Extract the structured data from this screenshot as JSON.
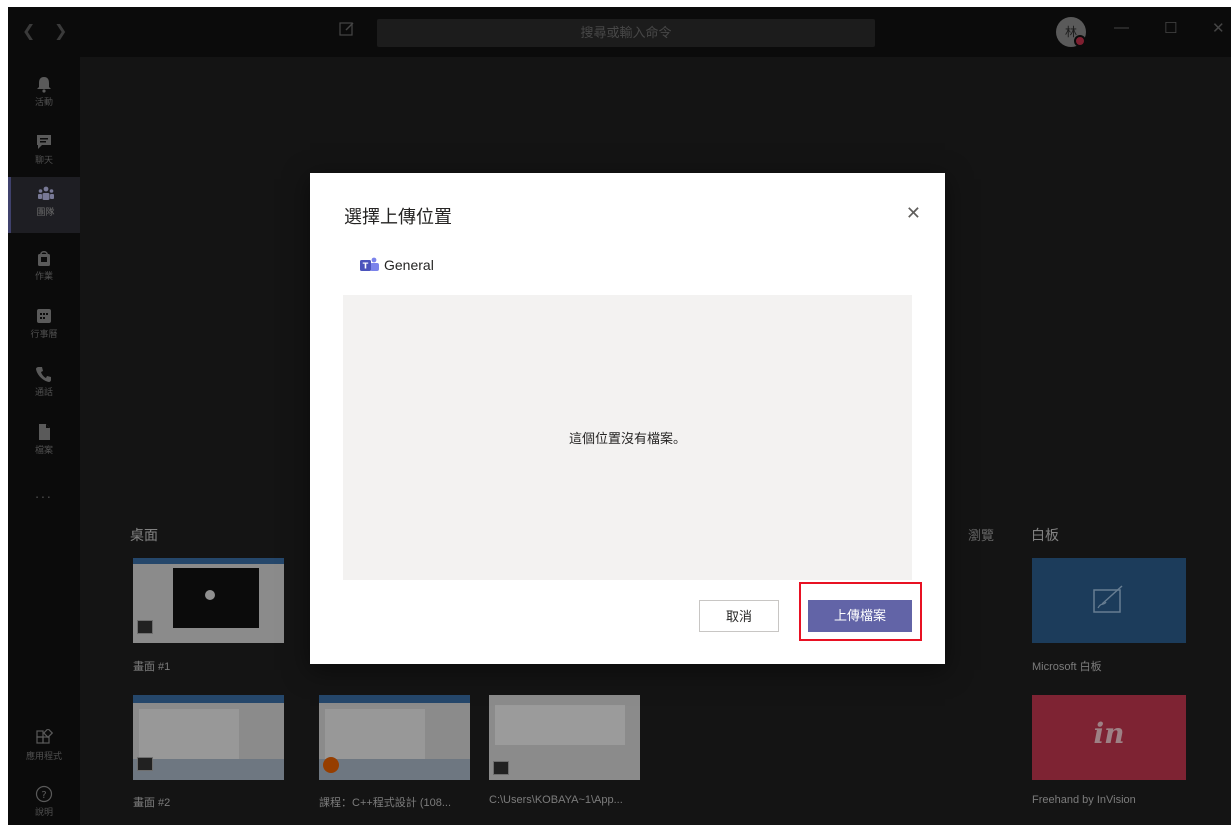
{
  "titlebar": {
    "search_placeholder": "搜尋或輸入命令",
    "avatar_initial": "林",
    "icons": [
      "back-arrow",
      "forward-arrow",
      "compose-icon",
      "minimize",
      "maximize",
      "close"
    ]
  },
  "rail": {
    "items": [
      {
        "label": "活動",
        "icon": "bell-icon"
      },
      {
        "label": "聊天",
        "icon": "chat-icon"
      },
      {
        "label": "團隊",
        "icon": "teams-icon",
        "active": true
      },
      {
        "label": "作業",
        "icon": "assignments-icon"
      },
      {
        "label": "行事曆",
        "icon": "calendar-icon"
      },
      {
        "label": "通話",
        "icon": "phone-icon"
      },
      {
        "label": "檔案",
        "icon": "files-icon"
      }
    ],
    "more": "...",
    "bottom_items": [
      {
        "label": "應用程式",
        "icon": "apps-icon"
      },
      {
        "label": "說明",
        "icon": "help-icon"
      }
    ]
  },
  "share_tray": {
    "desktop_title": "桌面",
    "browse_label": "瀏覽",
    "whiteboard_title": "白板",
    "windows": [
      {
        "label": "畫面 #1"
      },
      {
        "label": "畫面 #2"
      },
      {
        "label": "課程：C++程式設計 (108..."
      },
      {
        "label": "C:\\Users\\KOBAYA~1\\App..."
      }
    ],
    "whiteboards": [
      {
        "label": "Microsoft 白板",
        "color": "#2b5d8c"
      },
      {
        "label": "Freehand by InVision",
        "color": "#c2364f",
        "glyph": "in"
      }
    ]
  },
  "modal": {
    "title": "選擇上傳位置",
    "channel": "General",
    "empty_message": "這個位置沒有檔案。",
    "cancel_label": "取消",
    "upload_label": "上傳檔案",
    "accent": "#6264a7"
  }
}
